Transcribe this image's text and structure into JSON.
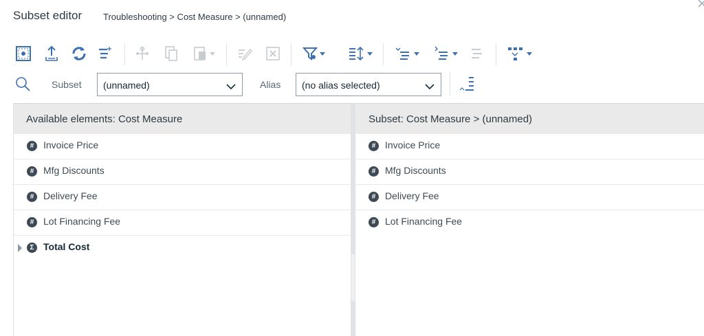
{
  "header": {
    "title": "Subset editor",
    "breadcrumb": "Troubleshooting > Cost Measure > (unnamed)"
  },
  "toolbar": {
    "icons": [
      "select-all-icon",
      "upload-icon",
      "refresh-icon",
      "insert-element-icon",
      "hierarchy-icon",
      "copy-icon",
      "paste-icon",
      "edit-icon",
      "delete-icon",
      "filter-icon",
      "sort-icon",
      "expand-above-icon",
      "expand-below-icon",
      "collapse-icon",
      "drill-icon"
    ],
    "accent": "#3d70b2",
    "disabled": "#c7ccd1"
  },
  "filter": {
    "subset_label": "Subset",
    "subset_value": "(unnamed)",
    "alias_label": "Alias",
    "alias_value": "(no alias selected)"
  },
  "available": {
    "header": "Available elements: Cost Measure",
    "items": [
      {
        "label": "Invoice Price",
        "icon": "#"
      },
      {
        "label": "Mfg Discounts",
        "icon": "#"
      },
      {
        "label": "Delivery Fee",
        "icon": "#"
      },
      {
        "label": "Lot Financing Fee",
        "icon": "#"
      },
      {
        "label": "Total Cost",
        "icon": "Σ"
      }
    ]
  },
  "subset": {
    "header": "Subset: Cost Measure > (unnamed)",
    "items": [
      {
        "label": "Invoice Price",
        "icon": "#"
      },
      {
        "label": "Mfg Discounts",
        "icon": "#"
      },
      {
        "label": "Delivery Fee",
        "icon": "#"
      },
      {
        "label": "Lot Financing Fee",
        "icon": "#"
      }
    ]
  }
}
